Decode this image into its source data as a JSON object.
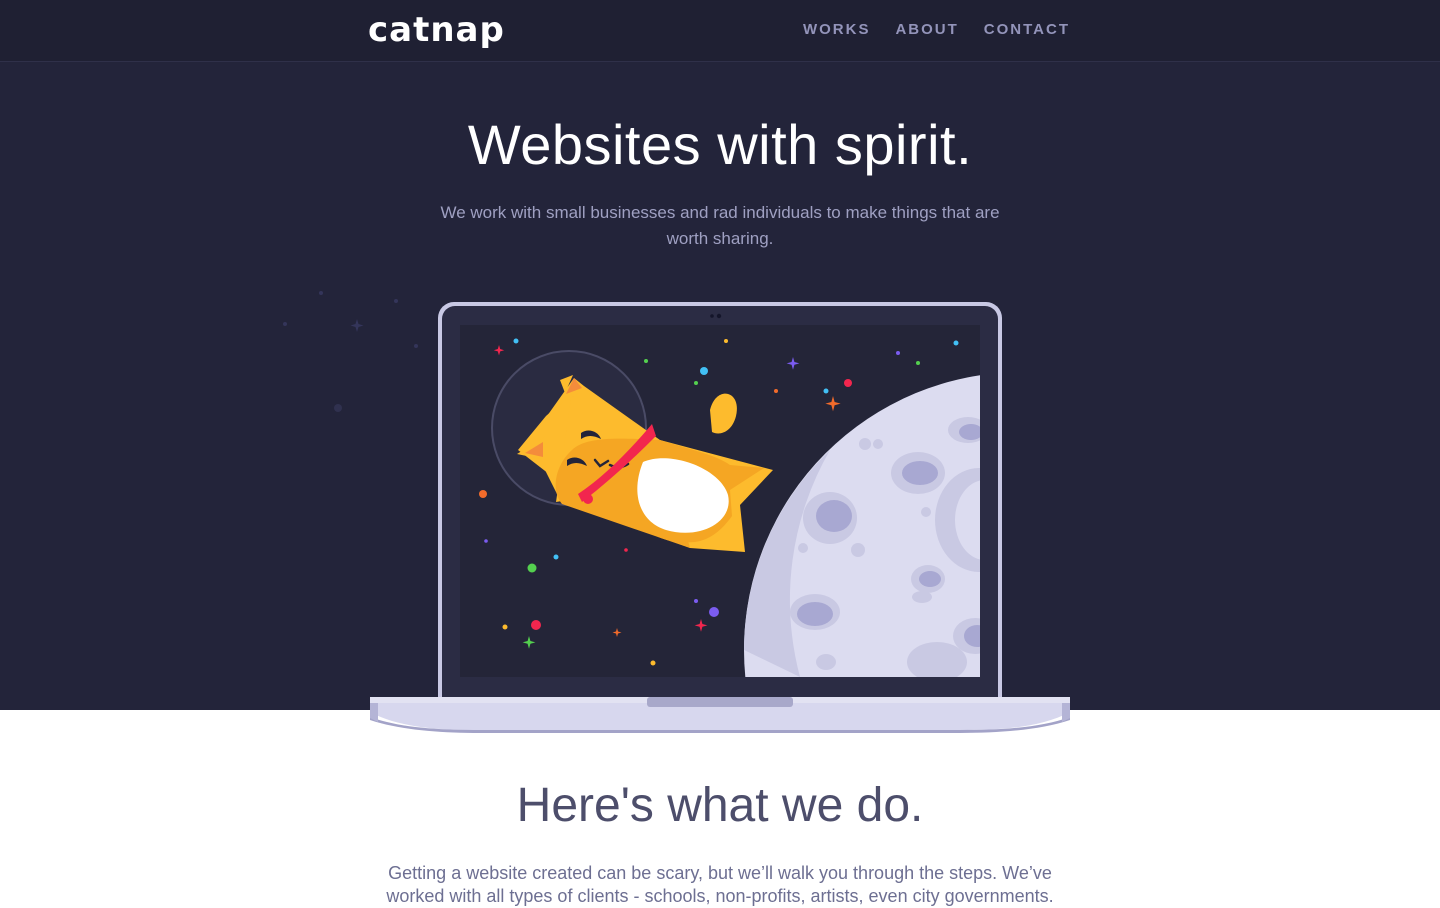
{
  "brand": {
    "logo_text": "catnap"
  },
  "nav": {
    "items": [
      {
        "label": "WORKS"
      },
      {
        "label": "ABOUT"
      },
      {
        "label": "CONTACT"
      }
    ]
  },
  "hero": {
    "headline": "Websites with spirit.",
    "subheadline": "We work with small businesses and rad individuals to make things that are worth sharing.",
    "illustration": "cat-astronaut-on-laptop"
  },
  "services": {
    "title": "Here's what we do.",
    "text": "Getting a website created can be scary, but we’ll walk you through the steps. We’ve worked with all types of clients - schools, non-profits, artists, even city governments."
  },
  "colors": {
    "hero_background": "#23243a",
    "nav_text": "#9394ba",
    "cat": "#fdbb2d",
    "collar": "#f2264e",
    "moon": "#dcdcf0"
  }
}
